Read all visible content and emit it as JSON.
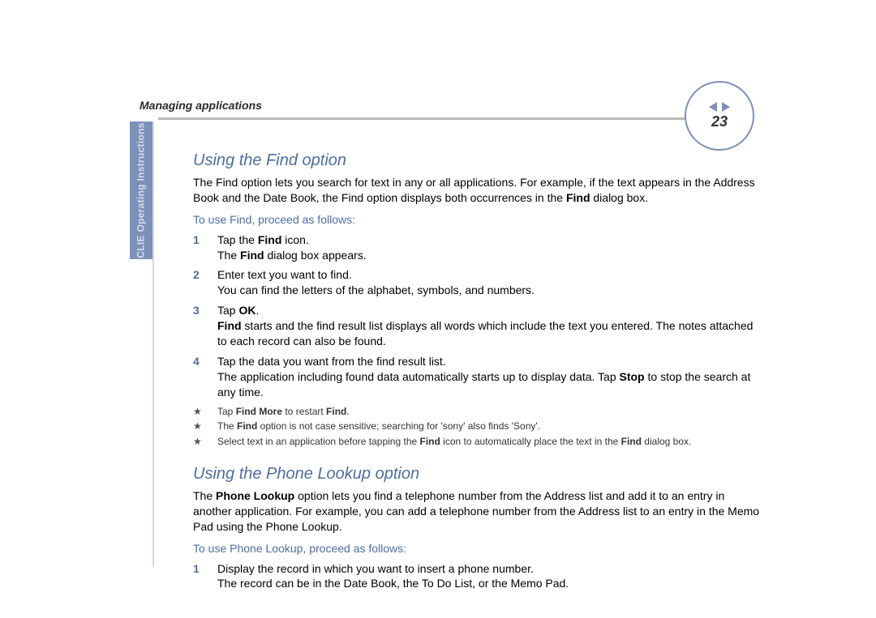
{
  "header": {
    "section_title": "Managing applications",
    "page_number": "23"
  },
  "side_tab": "CLIE Operating Instructions",
  "sections": {
    "find": {
      "heading": "Using the Find option",
      "intro_a": "The Find option lets you search for text in any or all applications. For example, if the text appears in the Address Book and the Date Book, the Find option displays both occurrences in the ",
      "intro_b_bold": "Find",
      "intro_c": " dialog box.",
      "subhead": "To use Find, proceed as follows:",
      "steps": {
        "s1": {
          "num": "1",
          "l1a": "Tap the ",
          "l1b_bold": "Find",
          "l1c": " icon.",
          "l2a": "The ",
          "l2b_bold": "Find",
          "l2c": " dialog box appears."
        },
        "s2": {
          "num": "2",
          "l1": "Enter text you want to find.",
          "l2": "You can find the letters of the alphabet, symbols, and numbers."
        },
        "s3": {
          "num": "3",
          "l1a": "Tap ",
          "l1b_bold": "OK",
          "l1c": ".",
          "l2a_bold": "Find",
          "l2b": " starts and the find result list displays all words which include the text you entered. The notes attached to each record can also be found."
        },
        "s4": {
          "num": "4",
          "l1": "Tap the data you want from the find result list.",
          "l2a": "The application including found data automatically starts up to display data. Tap ",
          "l2b_bold": "Stop",
          "l2c": " to stop the search at any time."
        }
      },
      "notes": {
        "star": "★",
        "n1": {
          "a": "Tap ",
          "b_bold": "Find More",
          "c": " to restart ",
          "d_bold": "Find",
          "e": "."
        },
        "n2": {
          "a": "The ",
          "b_bold": "Find",
          "c": " option is not case sensitive; searching for 'sony' also finds 'Sony'."
        },
        "n3": {
          "a": "Select text in an application before tapping the ",
          "b_bold": "Find",
          "c": " icon to automatically place the text in the ",
          "d_bold": "Find",
          "e": " dialog box."
        }
      }
    },
    "phone": {
      "heading": "Using the Phone Lookup option",
      "intro_a": "The ",
      "intro_b_bold": "Phone Lookup",
      "intro_c": " option lets you find a telephone number from the Address list and add it to an entry in another application. For example, you can add a telephone number from the Address list to an entry in the Memo Pad using the Phone Lookup.",
      "subhead": "To use Phone Lookup, proceed as follows:",
      "steps": {
        "s1": {
          "num": "1",
          "l1": "Display the record in which you want to insert a phone number.",
          "l2": "The record can be in the Date Book, the To Do List, or the Memo Pad."
        }
      }
    }
  }
}
